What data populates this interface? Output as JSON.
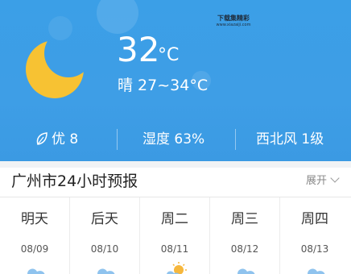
{
  "current": {
    "temperature": "32",
    "unit": "°C",
    "condition_range": "晴 27~34°C",
    "icon": "crescent-moon-icon"
  },
  "watermark": {
    "title": "下载集精彩",
    "url": "www.xiazaiji.com"
  },
  "stats": {
    "aqi": "优 8",
    "humidity": "湿度 63%",
    "wind": "西北风 1级"
  },
  "forecast": {
    "title": "广州市24小时预报",
    "expand_label": "展开",
    "days": [
      {
        "name": "明天",
        "date": "08/09",
        "icon": "cloud-icon"
      },
      {
        "name": "后天",
        "date": "08/10",
        "icon": "cloud-icon"
      },
      {
        "name": "周二",
        "date": "08/11",
        "icon": "partly-sunny-icon"
      },
      {
        "name": "周三",
        "date": "08/12",
        "icon": "cloud-icon"
      },
      {
        "name": "周四",
        "date": "08/13",
        "icon": "cloud-icon"
      }
    ]
  },
  "colors": {
    "hero_blue": "#3b9fe7",
    "moon_yellow": "#f7c233",
    "cloud_blue": "#8fc3ee",
    "sun_orange": "#f6b73c"
  }
}
